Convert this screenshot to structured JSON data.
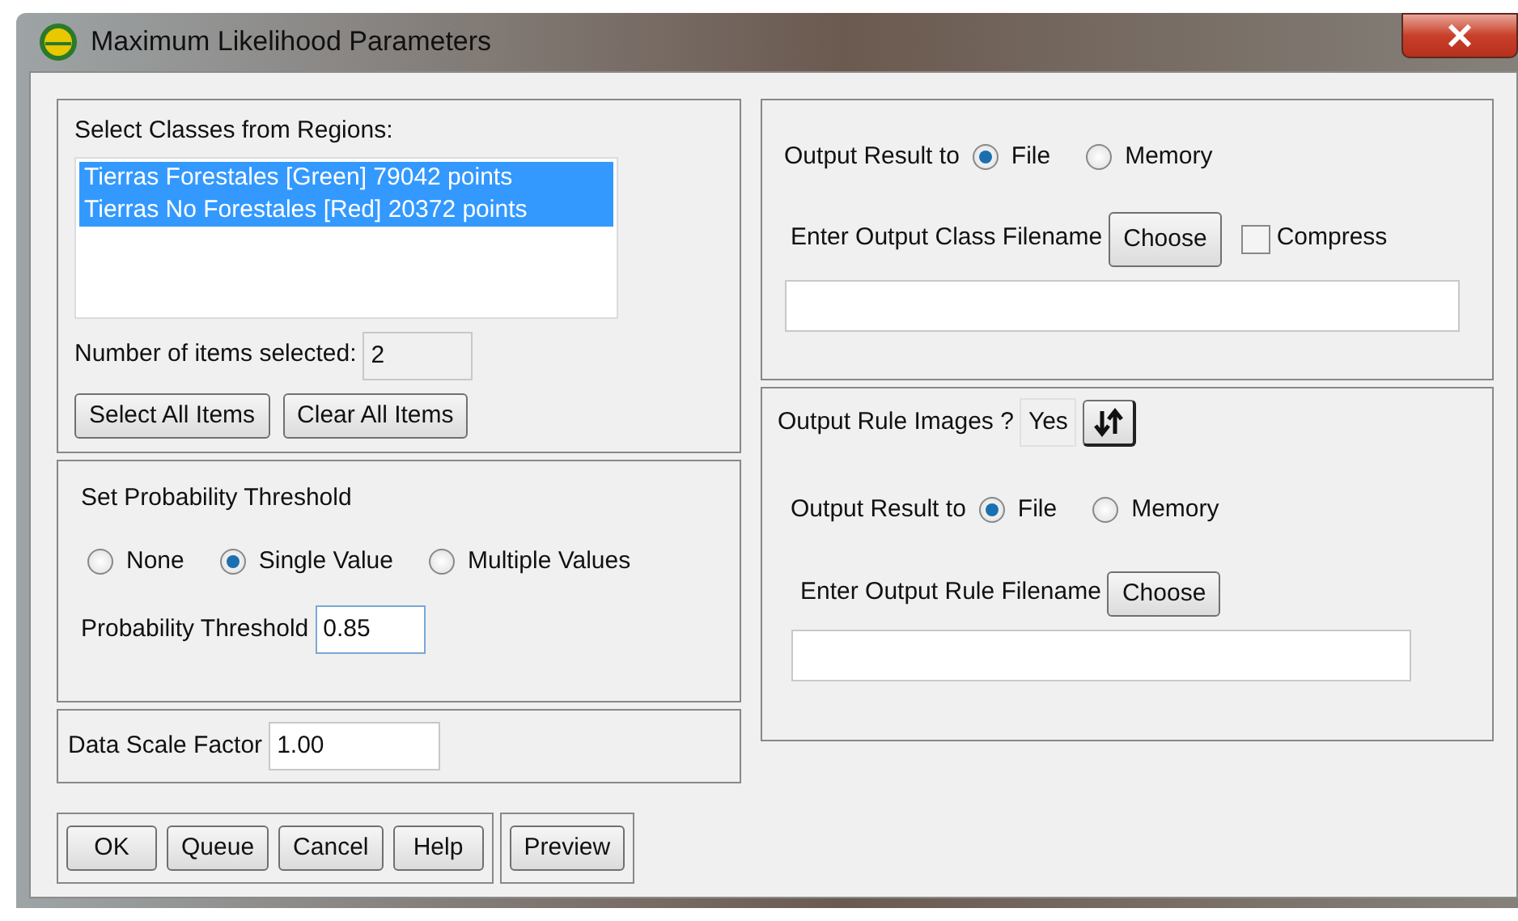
{
  "window": {
    "title": "Maximum Likelihood Parameters"
  },
  "classes": {
    "label": "Select Classes from Regions:",
    "items": [
      {
        "text": "Tierras Forestales [Green] 79042 points",
        "selected": true
      },
      {
        "text": "Tierras No Forestales [Red] 20372 points",
        "selected": true
      }
    ],
    "count_label": "Number of items selected:",
    "count": "2",
    "buttons": [
      "Select All Items",
      "Clear All Items"
    ]
  },
  "threshold": {
    "title": "Set Probability Threshold",
    "options": [
      {
        "label": "None",
        "selected": false
      },
      {
        "label": "Single Value",
        "selected": true
      },
      {
        "label": "Multiple Values",
        "selected": false
      }
    ],
    "field_label": "Probability Threshold",
    "value": "0.85"
  },
  "scale": {
    "label": "Data Scale Factor",
    "value": "1.00"
  },
  "output_class": {
    "label": "Output Result to",
    "options": [
      {
        "label": "File",
        "selected": true
      },
      {
        "label": "Memory",
        "selected": false
      }
    ],
    "filename_label": "Enter Output Class Filename",
    "choose": "Choose",
    "compress": {
      "label": "Compress",
      "checked": false
    }
  },
  "output_rule": {
    "images_label": "Output Rule Images ?",
    "images_value": "Yes",
    "label": "Output Result to",
    "options": [
      {
        "label": "File",
        "selected": true
      },
      {
        "label": "Memory",
        "selected": false
      }
    ],
    "filename_label": "Enter Output Rule Filename",
    "choose": "Choose"
  },
  "buttons": [
    "OK",
    "Queue",
    "Cancel",
    "Help"
  ],
  "preview": "Preview"
}
